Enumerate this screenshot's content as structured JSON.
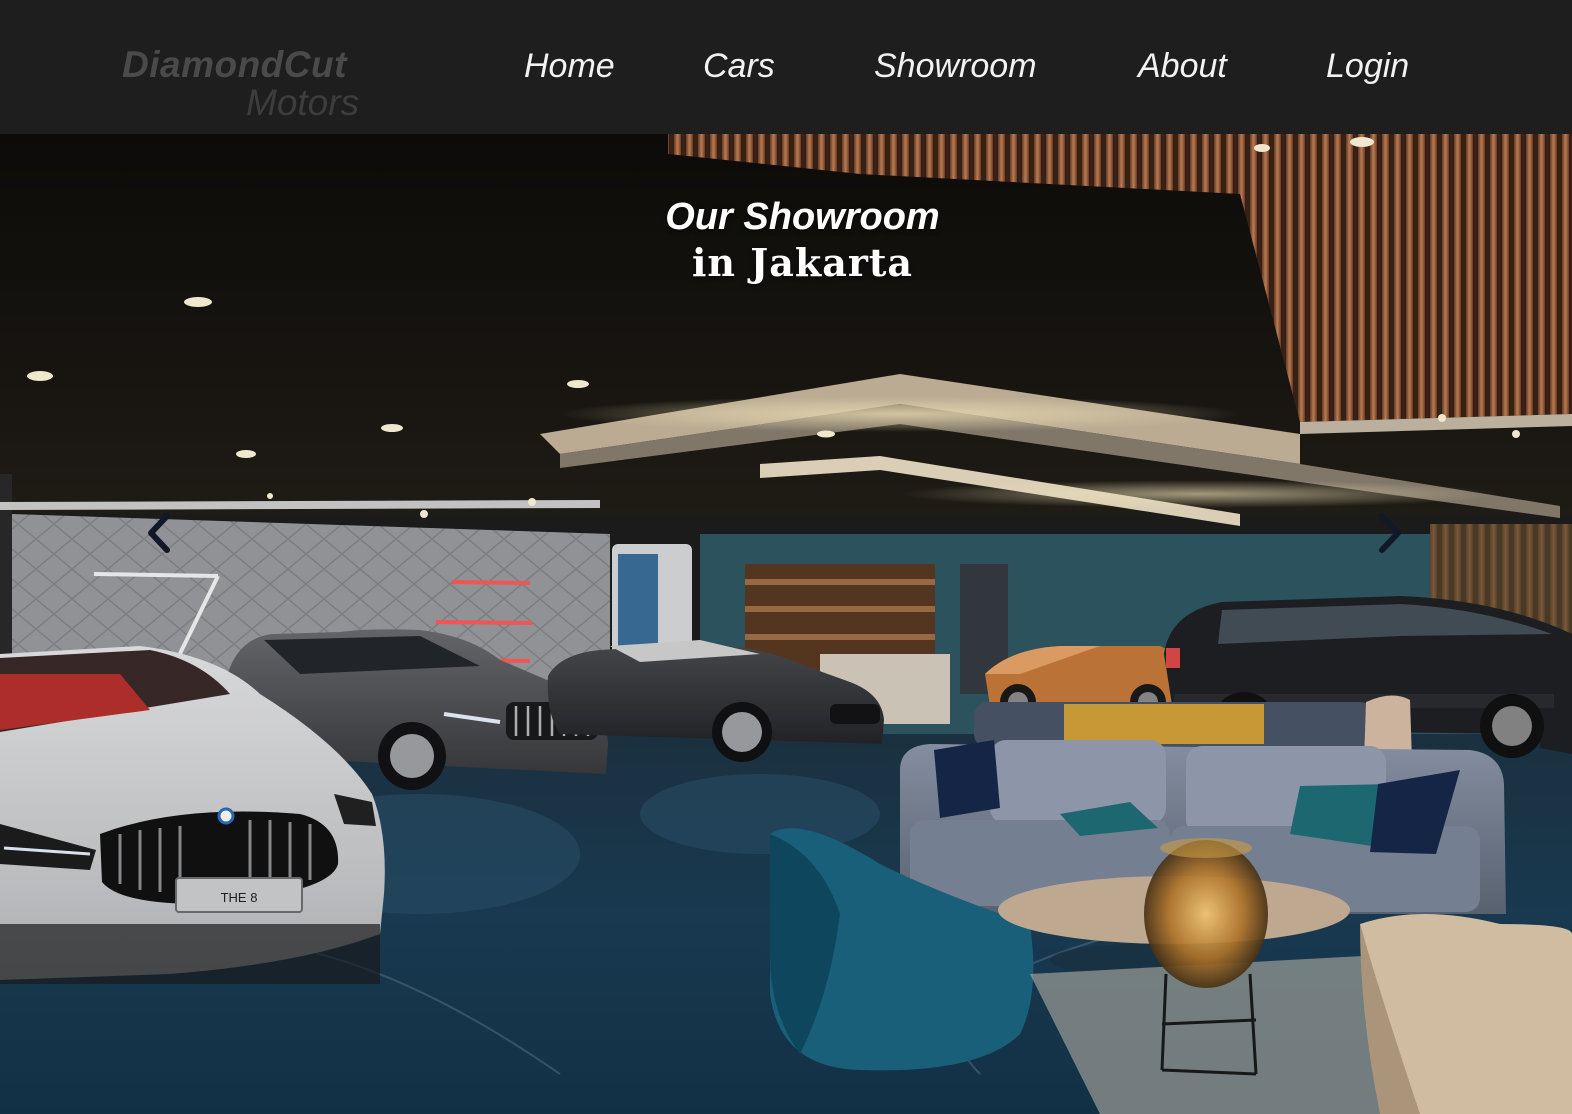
{
  "brand": {
    "name_line1": "DiamondCut",
    "name_line2": "Motors"
  },
  "nav": {
    "items": [
      {
        "label": "Home"
      },
      {
        "label": "Cars"
      },
      {
        "label": "Showroom"
      },
      {
        "label": "About"
      },
      {
        "label": "Login"
      }
    ]
  },
  "hero": {
    "title_line1": "Our Showroom",
    "title_line2": "in Jakarta",
    "image_description_name": "showroom-photo",
    "car_plate": "THE 8",
    "prev_icon": "chevron-left-icon",
    "next_icon": "chevron-right-icon"
  },
  "colors": {
    "header_bg": "#1e1e1e",
    "nav_text": "#f2f2f2",
    "logo_text": "#4a4a4a",
    "arrow": "#111827"
  }
}
